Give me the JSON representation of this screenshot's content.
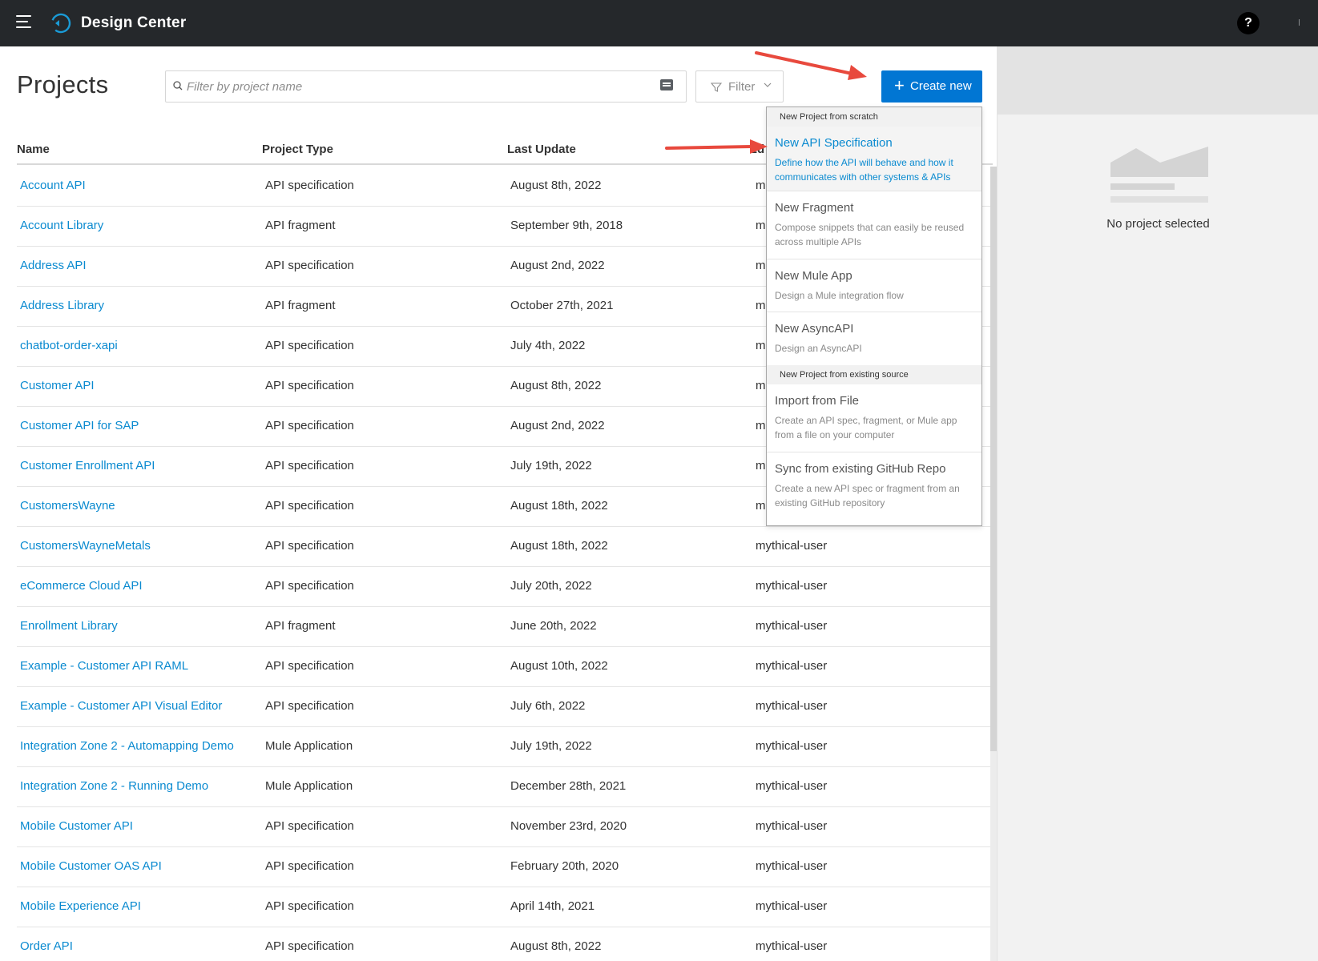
{
  "header": {
    "app_title": "Design Center",
    "help_label": "?"
  },
  "toolbar": {
    "page_title": "Projects",
    "search_placeholder": "Filter by project name",
    "filter_label": "Filter",
    "create_label": "Create new"
  },
  "table": {
    "columns": [
      "Name",
      "Project Type",
      "Last Update",
      "Ed"
    ],
    "rows": [
      {
        "name": "Account API",
        "type": "API specification",
        "date": "August 8th, 2022",
        "user": "m"
      },
      {
        "name": "Account Library",
        "type": "API fragment",
        "date": "September 9th, 2018",
        "user": "m"
      },
      {
        "name": "Address API",
        "type": "API specification",
        "date": "August 2nd, 2022",
        "user": "m"
      },
      {
        "name": "Address Library",
        "type": "API fragment",
        "date": "October 27th, 2021",
        "user": "m"
      },
      {
        "name": "chatbot-order-xapi",
        "type": "API specification",
        "date": "July 4th, 2022",
        "user": "m"
      },
      {
        "name": "Customer API",
        "type": "API specification",
        "date": "August 8th, 2022",
        "user": "m"
      },
      {
        "name": "Customer API for SAP",
        "type": "API specification",
        "date": "August 2nd, 2022",
        "user": "m"
      },
      {
        "name": "Customer Enrollment API",
        "type": "API specification",
        "date": "July 19th, 2022",
        "user": "m"
      },
      {
        "name": "CustomersWayne",
        "type": "API specification",
        "date": "August 18th, 2022",
        "user": "m"
      },
      {
        "name": "CustomersWayneMetals",
        "type": "API specification",
        "date": "August 18th, 2022",
        "user": "mythical-user"
      },
      {
        "name": "eCommerce Cloud API",
        "type": "API specification",
        "date": "July 20th, 2022",
        "user": "mythical-user"
      },
      {
        "name": "Enrollment Library",
        "type": "API fragment",
        "date": "June 20th, 2022",
        "user": "mythical-user"
      },
      {
        "name": "Example - Customer API RAML",
        "type": "API specification",
        "date": "August 10th, 2022",
        "user": "mythical-user"
      },
      {
        "name": "Example - Customer API Visual Editor",
        "type": "API specification",
        "date": "July 6th, 2022",
        "user": "mythical-user"
      },
      {
        "name": "Integration Zone 2 - Automapping Demo",
        "type": "Mule Application",
        "date": "July 19th, 2022",
        "user": "mythical-user"
      },
      {
        "name": "Integration Zone 2 - Running Demo",
        "type": "Mule Application",
        "date": "December 28th, 2021",
        "user": "mythical-user"
      },
      {
        "name": "Mobile Customer API",
        "type": "API specification",
        "date": "November 23rd, 2020",
        "user": "mythical-user"
      },
      {
        "name": "Mobile Customer OAS API",
        "type": "API specification",
        "date": "February 20th, 2020",
        "user": "mythical-user"
      },
      {
        "name": "Mobile Experience API",
        "type": "API specification",
        "date": "April 14th, 2021",
        "user": "mythical-user"
      },
      {
        "name": "Order API",
        "type": "API specification",
        "date": "August 8th, 2022",
        "user": "mythical-user"
      }
    ]
  },
  "dropdown": {
    "section_scratch": "New Project from scratch",
    "section_existing": "New Project from existing source",
    "items": [
      {
        "title": "New API Specification",
        "desc": "Define how the API will behave and how it communicates with other systems & APIs"
      },
      {
        "title": "New Fragment",
        "desc": "Compose snippets that can easily be reused across multiple APIs"
      },
      {
        "title": "New Mule App",
        "desc": "Design a Mule integration flow"
      },
      {
        "title": "New AsyncAPI",
        "desc": "Design an AsyncAPI"
      },
      {
        "title": "Import from File",
        "desc": "Create an API spec, fragment, or Mule app from a file on your computer"
      },
      {
        "title": "Sync from existing GitHub Repo",
        "desc": "Create a new API spec or fragment from an existing GitHub repository"
      }
    ]
  },
  "right_panel": {
    "empty_label": "No project selected"
  },
  "colors": {
    "topbar": "#25282b",
    "accent": "#0176d3",
    "link": "#0a8ad0",
    "annotation": "#e8493d"
  },
  "icons": {
    "menu": "hamburger-icon",
    "logo": "design-center-logo-icon",
    "search": "search-icon",
    "keyboard": "keyboard-icon",
    "filter": "filter-icon",
    "chevron": "chevron-down-icon",
    "plus": "plus-icon",
    "help": "help-icon"
  }
}
